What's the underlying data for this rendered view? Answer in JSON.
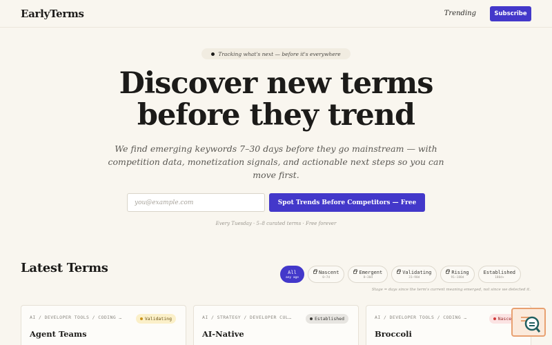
{
  "header": {
    "logo": "EarlyTerms",
    "nav_trending": "Trending",
    "subscribe_label": "Subscribe"
  },
  "hero": {
    "pill_text": "Tracking what's next — before it's everywhere",
    "title_line1": "Discover new terms",
    "title_line2": "before they trend",
    "subtitle": "We find emerging keywords 7–30 days before they go mainstream — with competition data, monetization signals, and actionable next steps so you can move first.",
    "email_placeholder": "you@example.com",
    "cta_label": "Spot Trends Before Competitors — Free",
    "fineprint": "Every Tuesday · 5–8 curated terms · Free forever"
  },
  "latest": {
    "title": "Latest Terms",
    "filters": [
      {
        "label": "All",
        "sub": "any age",
        "active": true,
        "locked": false
      },
      {
        "label": "Nascent",
        "sub": "0–7d",
        "active": false,
        "locked": true
      },
      {
        "label": "Emergent",
        "sub": "8–30d",
        "active": false,
        "locked": true
      },
      {
        "label": "Validating",
        "sub": "31–90d",
        "active": false,
        "locked": true
      },
      {
        "label": "Rising",
        "sub": "91–180d",
        "active": false,
        "locked": true
      },
      {
        "label": "Established",
        "sub": "180d+",
        "active": false,
        "locked": false
      }
    ],
    "stage_note": "Stage = days since the term's current meaning emerged, not since we detected it.",
    "cards": [
      {
        "category": "AI / DEVELOPER TOOLS / CODING …",
        "badge": "Validating",
        "term": "Agent Teams"
      },
      {
        "category": "AI / STRATEGY / DEVELOPER CUL…",
        "badge": "Established",
        "term": "AI-Native"
      },
      {
        "category": "AI / DEVELOPER TOOLS / CODING …",
        "badge": "Nascent",
        "term": "Broccoli"
      }
    ]
  },
  "widget": {
    "icon": "search-chat-icon"
  },
  "colors": {
    "accent": "#4338ca",
    "background": "#f9f6ef"
  }
}
